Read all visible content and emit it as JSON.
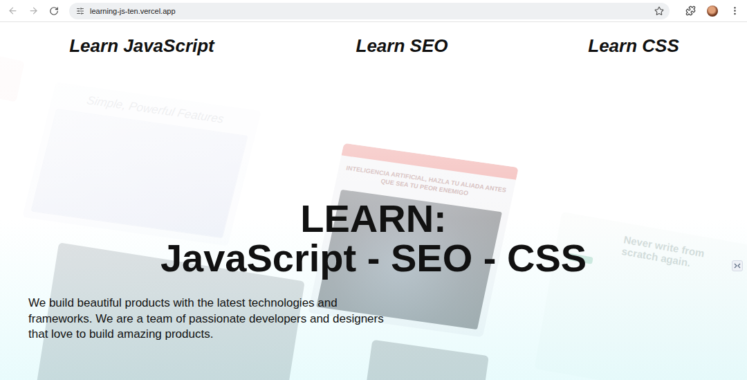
{
  "browser": {
    "url": "learning-js-ten.vercel.app"
  },
  "nav": [
    {
      "label": "Learn JavaScript"
    },
    {
      "label": "Learn SEO"
    },
    {
      "label": "Learn CSS"
    }
  ],
  "hero": {
    "title": "LEARN:",
    "subtitle": "JavaScript - SEO - CSS",
    "description": "We build beautiful products with the latest technologies and frameworks. We are a team of passionate developers and designers that love to build amazing products."
  },
  "collage": {
    "features_card": {
      "title": "Simple, Powerful Features"
    },
    "news_card": {
      "title": "INTELIGENCIA ARTIFICIAL, HAZLA TU ALIADA ANTES QUE SEA TU PEOR ENEMIGO"
    },
    "writer_card": {
      "title": "Never write from scratch again."
    }
  }
}
